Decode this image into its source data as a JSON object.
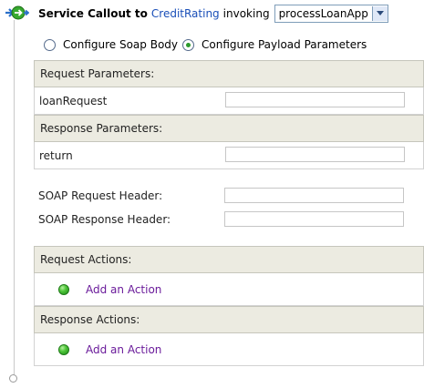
{
  "header": {
    "prefix": "Service Callout to",
    "service": "CreditRating",
    "middle": "invoking",
    "operation": "processLoanApp"
  },
  "options": {
    "soap_body": "Configure Soap Body",
    "payload_params": "Configure Payload Parameters",
    "selected": "payload_params"
  },
  "request_params": {
    "title": "Request Parameters:",
    "rows": [
      {
        "name": "loanRequest",
        "value": ""
      }
    ]
  },
  "response_params": {
    "title": "Response Parameters:",
    "rows": [
      {
        "name": "return",
        "value": ""
      }
    ]
  },
  "soap_headers": {
    "request_label": "SOAP Request Header:",
    "request_value": "",
    "response_label": "SOAP Response Header:",
    "response_value": ""
  },
  "request_actions": {
    "title": "Request Actions:",
    "add_label": "Add an Action"
  },
  "response_actions": {
    "title": "Response Actions:",
    "add_label": "Add an Action"
  },
  "colors": {
    "link_blue": "#1a4fb8",
    "action_link_purple": "#6a1b9a",
    "section_header_bg": "#ecebe1",
    "action_dot_green": "#2db626"
  },
  "icons": {
    "callout": "service-callout-icon",
    "dropdown": "chevron-down-icon",
    "add_action": "green-dot-icon"
  }
}
